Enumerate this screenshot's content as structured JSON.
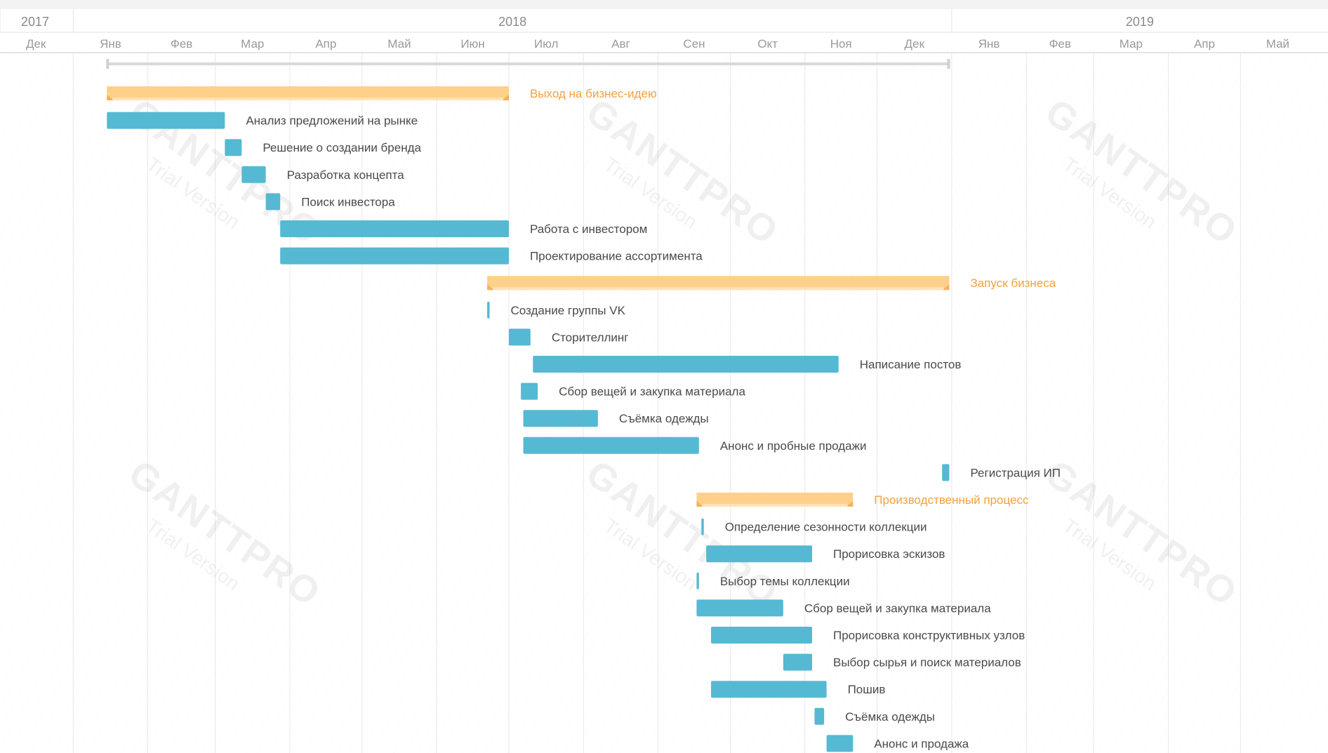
{
  "chart_data": {
    "type": "gantt",
    "app": "GANTTPRO",
    "watermark": {
      "brand": "GANTTPRO",
      "text": "Trial Version"
    },
    "colors": {
      "task": "#55b9d3",
      "group": "#ffd08a",
      "group_label": "#f5a03a",
      "grid": "#e8e8e8"
    },
    "years": [
      {
        "label": "2017",
        "start": "2017-12-01",
        "end": "2018-01-01"
      },
      {
        "label": "2018",
        "start": "2018-01-01",
        "end": "2019-01-01"
      },
      {
        "label": "2019",
        "start": "2019-01-01",
        "end": "2019-06-01"
      }
    ],
    "months": [
      {
        "label": "Дек",
        "start": "2017-12-01"
      },
      {
        "label": "Янв",
        "start": "2018-01-01"
      },
      {
        "label": "Фев",
        "start": "2018-02-01"
      },
      {
        "label": "Мар",
        "start": "2018-03-01"
      },
      {
        "label": "Апр",
        "start": "2018-04-01"
      },
      {
        "label": "Май",
        "start": "2018-05-01"
      },
      {
        "label": "Июн",
        "start": "2018-06-01"
      },
      {
        "label": "Июл",
        "start": "2018-07-01"
      },
      {
        "label": "Авг",
        "start": "2018-08-01"
      },
      {
        "label": "Сен",
        "start": "2018-09-01"
      },
      {
        "label": "Окт",
        "start": "2018-10-01"
      },
      {
        "label": "Ноя",
        "start": "2018-11-01"
      },
      {
        "label": "Дек",
        "start": "2018-12-01"
      },
      {
        "label": "Янв",
        "start": "2019-01-01"
      },
      {
        "label": "Фев",
        "start": "2019-02-01"
      },
      {
        "label": "Мар",
        "start": "2019-03-01"
      },
      {
        "label": "Апр",
        "start": "2019-04-01"
      },
      {
        "label": "Май",
        "start": "2019-05-01"
      }
    ],
    "project": {
      "start": "2018-01-15",
      "end": "2018-12-31"
    },
    "tasks": [
      {
        "name": "Выход на бизнес-идею",
        "type": "group",
        "start": "2018-01-15",
        "end": "2018-07-01"
      },
      {
        "name": "Анализ предложений на рынке",
        "type": "task",
        "start": "2018-01-15",
        "end": "2018-03-05"
      },
      {
        "name": "Решение о создании бренда",
        "type": "task",
        "start": "2018-03-05",
        "end": "2018-03-12"
      },
      {
        "name": "Разработка концепта",
        "type": "task",
        "start": "2018-03-12",
        "end": "2018-03-22"
      },
      {
        "name": "Поиск инвестора",
        "type": "task",
        "start": "2018-03-22",
        "end": "2018-03-28"
      },
      {
        "name": "Работа с инвестором",
        "type": "task",
        "start": "2018-03-28",
        "end": "2018-07-01"
      },
      {
        "name": "Проектирование ассортимента",
        "type": "task",
        "start": "2018-03-28",
        "end": "2018-07-01"
      },
      {
        "name": "Запуск бизнеса",
        "type": "group",
        "start": "2018-06-22",
        "end": "2018-12-31"
      },
      {
        "name": "Создание группы VK",
        "type": "task",
        "start": "2018-06-22",
        "end": "2018-06-23"
      },
      {
        "name": "Сторителлинг",
        "type": "task",
        "start": "2018-07-01",
        "end": "2018-07-10"
      },
      {
        "name": "Написание постов",
        "type": "task",
        "start": "2018-07-11",
        "end": "2018-11-15"
      },
      {
        "name": "Сбор вещей и закупка материала",
        "type": "task",
        "start": "2018-07-06",
        "end": "2018-07-13"
      },
      {
        "name": "Съёмка одежды",
        "type": "task",
        "start": "2018-07-07",
        "end": "2018-08-07"
      },
      {
        "name": "Анонс и пробные продажи",
        "type": "task",
        "start": "2018-07-07",
        "end": "2018-09-18"
      },
      {
        "name": "Регистрация ИП",
        "type": "task",
        "start": "2018-12-28",
        "end": "2018-12-31"
      },
      {
        "name": "Производственный процесс",
        "type": "group",
        "start": "2018-09-17",
        "end": "2018-11-21"
      },
      {
        "name": "Определение сезонности коллекции",
        "type": "task",
        "start": "2018-09-19",
        "end": "2018-09-20"
      },
      {
        "name": "Прорисовка эскизов",
        "type": "task",
        "start": "2018-09-21",
        "end": "2018-11-04"
      },
      {
        "name": "Выбор темы коллекции",
        "type": "task",
        "start": "2018-09-17",
        "end": "2018-09-18"
      },
      {
        "name": "Сбор вещей и закупка материала",
        "type": "task",
        "start": "2018-09-17",
        "end": "2018-10-23"
      },
      {
        "name": "Прорисовка конструктивных узлов",
        "type": "task",
        "start": "2018-09-23",
        "end": "2018-11-04"
      },
      {
        "name": "Выбор сырья и поиск материалов",
        "type": "task",
        "start": "2018-10-23",
        "end": "2018-11-04"
      },
      {
        "name": "Пошив",
        "type": "task",
        "start": "2018-09-23",
        "end": "2018-11-10"
      },
      {
        "name": "Съёмка одежды",
        "type": "task",
        "start": "2018-11-05",
        "end": "2018-11-09"
      },
      {
        "name": "Анонс и продажа",
        "type": "task",
        "start": "2018-11-10",
        "end": "2018-11-21"
      }
    ]
  }
}
